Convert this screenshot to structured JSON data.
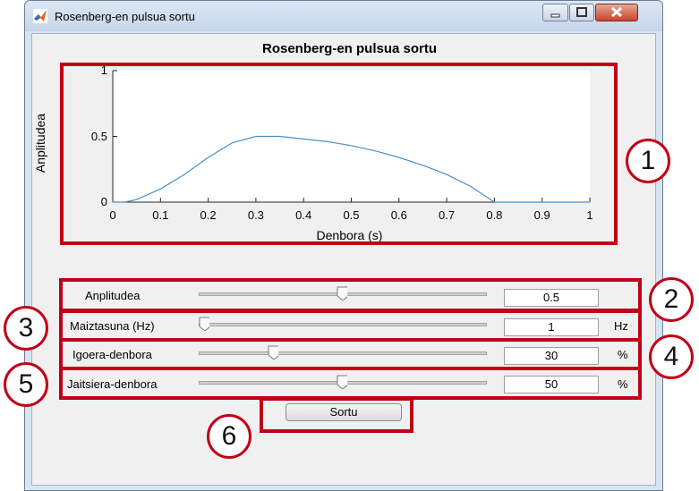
{
  "window": {
    "title": "Rosenberg-en pulsua sortu"
  },
  "plot": {
    "title": "Rosenberg-en pulsua sortu",
    "xlabel": "Denbora (s)",
    "ylabel": "Anplitudea",
    "xticks": [
      "0",
      "0.1",
      "0.2",
      "0.3",
      "0.4",
      "0.5",
      "0.6",
      "0.7",
      "0.8",
      "0.9",
      "1"
    ],
    "yticks": [
      "0",
      "0.5",
      "1"
    ]
  },
  "chart_data": {
    "type": "line",
    "title": "Rosenberg-en pulsua sortu",
    "xlabel": "Denbora (s)",
    "ylabel": "Anplitudea",
    "xlim": [
      0,
      1
    ],
    "ylim": [
      0,
      1
    ],
    "x": [
      0,
      0.025,
      0.05,
      0.1,
      0.15,
      0.2,
      0.25,
      0.3,
      0.35,
      0.4,
      0.45,
      0.5,
      0.55,
      0.6,
      0.65,
      0.7,
      0.75,
      0.8,
      0.85,
      0.9,
      0.95,
      1.0
    ],
    "y": [
      0,
      0.0,
      0.02,
      0.1,
      0.21,
      0.34,
      0.45,
      0.5,
      0.5,
      0.48,
      0.46,
      0.43,
      0.39,
      0.34,
      0.28,
      0.21,
      0.12,
      0.0,
      0,
      0,
      0,
      0
    ],
    "series_color": "#4a90c8"
  },
  "controls": [
    {
      "label": "Anplitudea",
      "value": "0.5",
      "unit": "",
      "slider": 0.5
    },
    {
      "label": "Maiztasuna (Hz)",
      "value": "1",
      "unit": "Hz",
      "slider": 0.0
    },
    {
      "label": "Igoera-denbora",
      "value": "30",
      "unit": "%",
      "slider": 0.25
    },
    {
      "label": "Jaitsiera-denbora",
      "value": "50",
      "unit": "%",
      "slider": 0.5
    }
  ],
  "button": {
    "label": "Sortu"
  },
  "badges": [
    "1",
    "2",
    "3",
    "4",
    "5",
    "6"
  ],
  "colors": {
    "annotation": "#c00018",
    "accent": "#4a90c8"
  }
}
